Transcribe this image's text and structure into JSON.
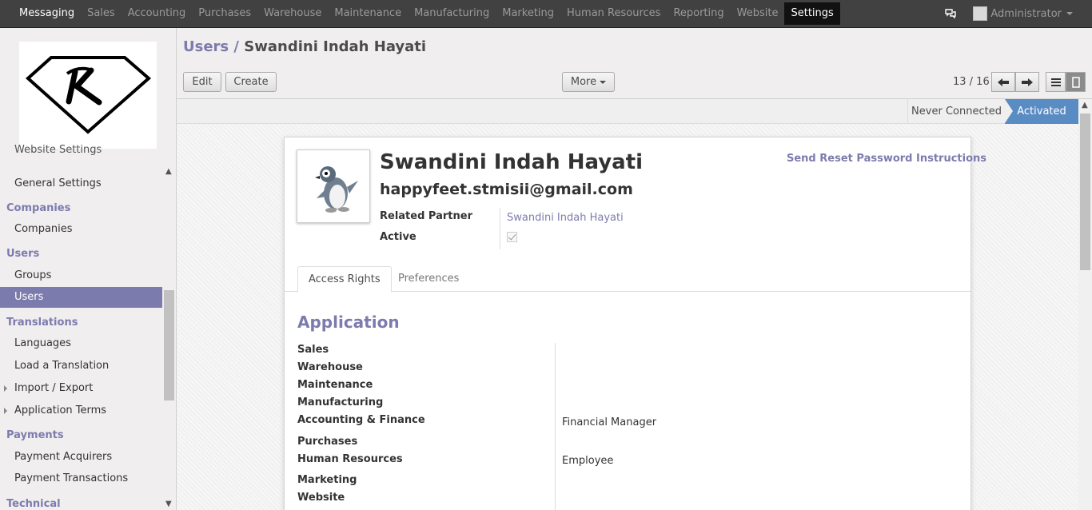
{
  "topmenu": {
    "items": [
      {
        "label": "Messaging"
      },
      {
        "label": "Sales"
      },
      {
        "label": "Accounting"
      },
      {
        "label": "Purchases"
      },
      {
        "label": "Warehouse"
      },
      {
        "label": "Maintenance"
      },
      {
        "label": "Manufacturing"
      },
      {
        "label": "Marketing"
      },
      {
        "label": "Human Resources"
      },
      {
        "label": "Reporting"
      },
      {
        "label": "Website"
      },
      {
        "label": "Settings"
      }
    ],
    "active": "Settings",
    "user": "Administrator",
    "chat_icon": "chat-bubbles-icon"
  },
  "sidebar": {
    "partial_top": "Website Settings",
    "entries": [
      {
        "type": "item",
        "label": "General Settings"
      },
      {
        "type": "head",
        "label": "Companies"
      },
      {
        "type": "item",
        "label": "Companies"
      },
      {
        "type": "head",
        "label": "Users"
      },
      {
        "type": "item",
        "label": "Groups"
      },
      {
        "type": "item",
        "label": "Users",
        "active": true
      },
      {
        "type": "head",
        "label": "Translations"
      },
      {
        "type": "item",
        "label": "Languages"
      },
      {
        "type": "item",
        "label": "Load a Translation"
      },
      {
        "type": "item",
        "label": "Import / Export",
        "expandable": true
      },
      {
        "type": "item",
        "label": "Application Terms",
        "expandable": true
      },
      {
        "type": "head",
        "label": "Payments"
      },
      {
        "type": "item",
        "label": "Payment Acquirers"
      },
      {
        "type": "item",
        "label": "Payment Transactions"
      },
      {
        "type": "head",
        "label": "Technical"
      }
    ]
  },
  "header": {
    "breadcrumb_parent": "Users",
    "breadcrumb_sep": "/",
    "breadcrumb_current": "Swandini Indah Hayati",
    "edit_label": "Edit",
    "create_label": "Create",
    "more_label": "More",
    "pager": "13 / 16"
  },
  "status": {
    "never_connected": "Never Connected",
    "activated": "Activated"
  },
  "form": {
    "name": "Swandini Indah Hayati",
    "email": "happyfeet.stmisii@gmail.com",
    "reset_link": "Send Reset Password Instructions",
    "related_partner_label": "Related Partner",
    "related_partner_value": "Swandini Indah Hayati",
    "active_label": "Active",
    "active_checked": true,
    "tabs": {
      "access_rights": "Access Rights",
      "preferences": "Preferences"
    },
    "section_title": "Application",
    "applications": [
      {
        "label": "Sales",
        "value": ""
      },
      {
        "label": "Warehouse",
        "value": ""
      },
      {
        "label": "Maintenance",
        "value": ""
      },
      {
        "label": "Manufacturing",
        "value": ""
      },
      {
        "label": "Accounting & Finance",
        "value": "Financial Manager"
      },
      {
        "label": "Purchases",
        "value": ""
      },
      {
        "label": "Human Resources",
        "value": "Employee"
      },
      {
        "label": "Marketing",
        "value": ""
      },
      {
        "label": "Website",
        "value": ""
      }
    ]
  },
  "colors": {
    "accent": "#7c7bad",
    "topbar": "#414141",
    "status_active": "#5a8cc4"
  }
}
